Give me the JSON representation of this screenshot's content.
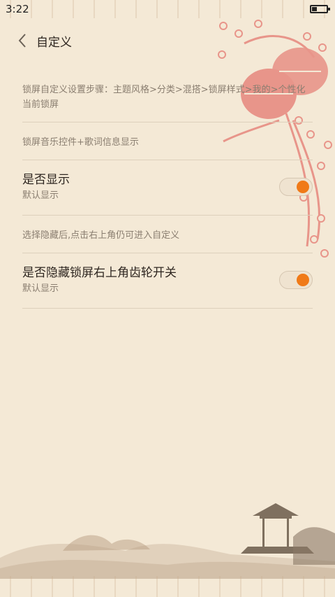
{
  "status_bar": {
    "time": "3:22",
    "battery_icon": "battery-low-icon"
  },
  "header": {
    "title": "自定义",
    "back_icon": "chevron-left-icon"
  },
  "steps_hint": "锁屏自定义设置步骤：主题风格>分类>混搭>锁屏样式>我的>个性化当前锁屏",
  "section1_hint": "锁屏音乐控件+歌词信息显示",
  "setting1": {
    "title": "是否显示",
    "subtitle": "默认显示",
    "enabled": true
  },
  "section2_hint": "选择隐藏后,点击右上角仍可进入自定义",
  "setting2": {
    "title": "是否隐藏锁屏右上角齿轮开关",
    "subtitle": "默认显示",
    "enabled": true
  },
  "colors": {
    "background": "#f4e9d6",
    "accent": "#f07a18",
    "lantern": "#e8958a"
  }
}
